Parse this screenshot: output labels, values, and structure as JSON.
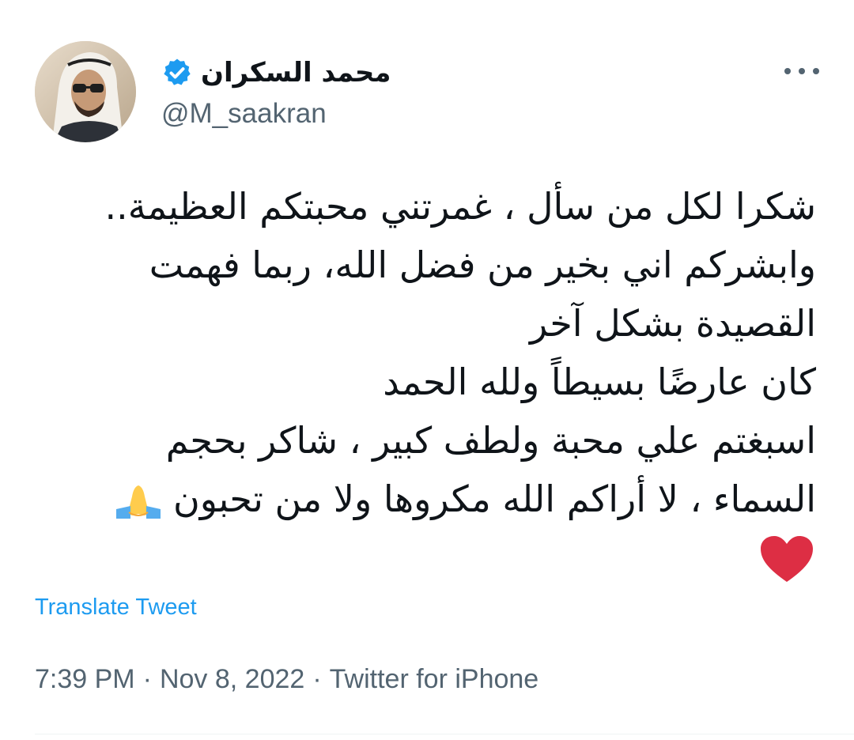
{
  "tweet": {
    "author": {
      "display_name": "محمد السكران",
      "handle": "@M_saakran",
      "verified": true
    },
    "lines": [
      "شكرا لكل من سأل ، غمرتني محبتكم العظيمة..",
      "وابشركم اني بخير من فضل الله، ربما فهمت",
      "القصيدة بشكل آخر",
      "كان عارضًا بسيطاً ولله الحمد",
      "اسبغتم علي محبة ولطف كبير ، شاكر بحجم",
      "السماء ، لا أراكم الله مكروها ولا من تحبون"
    ],
    "emojis": [
      "folded-hands",
      "red-heart"
    ],
    "translate_label": "Translate Tweet",
    "time": "7:39 PM",
    "date": "Nov 8, 2022",
    "source": "Twitter for iPhone",
    "separator": "·"
  },
  "colors": {
    "accent": "#1d9bf0",
    "secondary_text": "#536471",
    "heart": "#dd2e44",
    "hands": "#ffcc4d"
  }
}
